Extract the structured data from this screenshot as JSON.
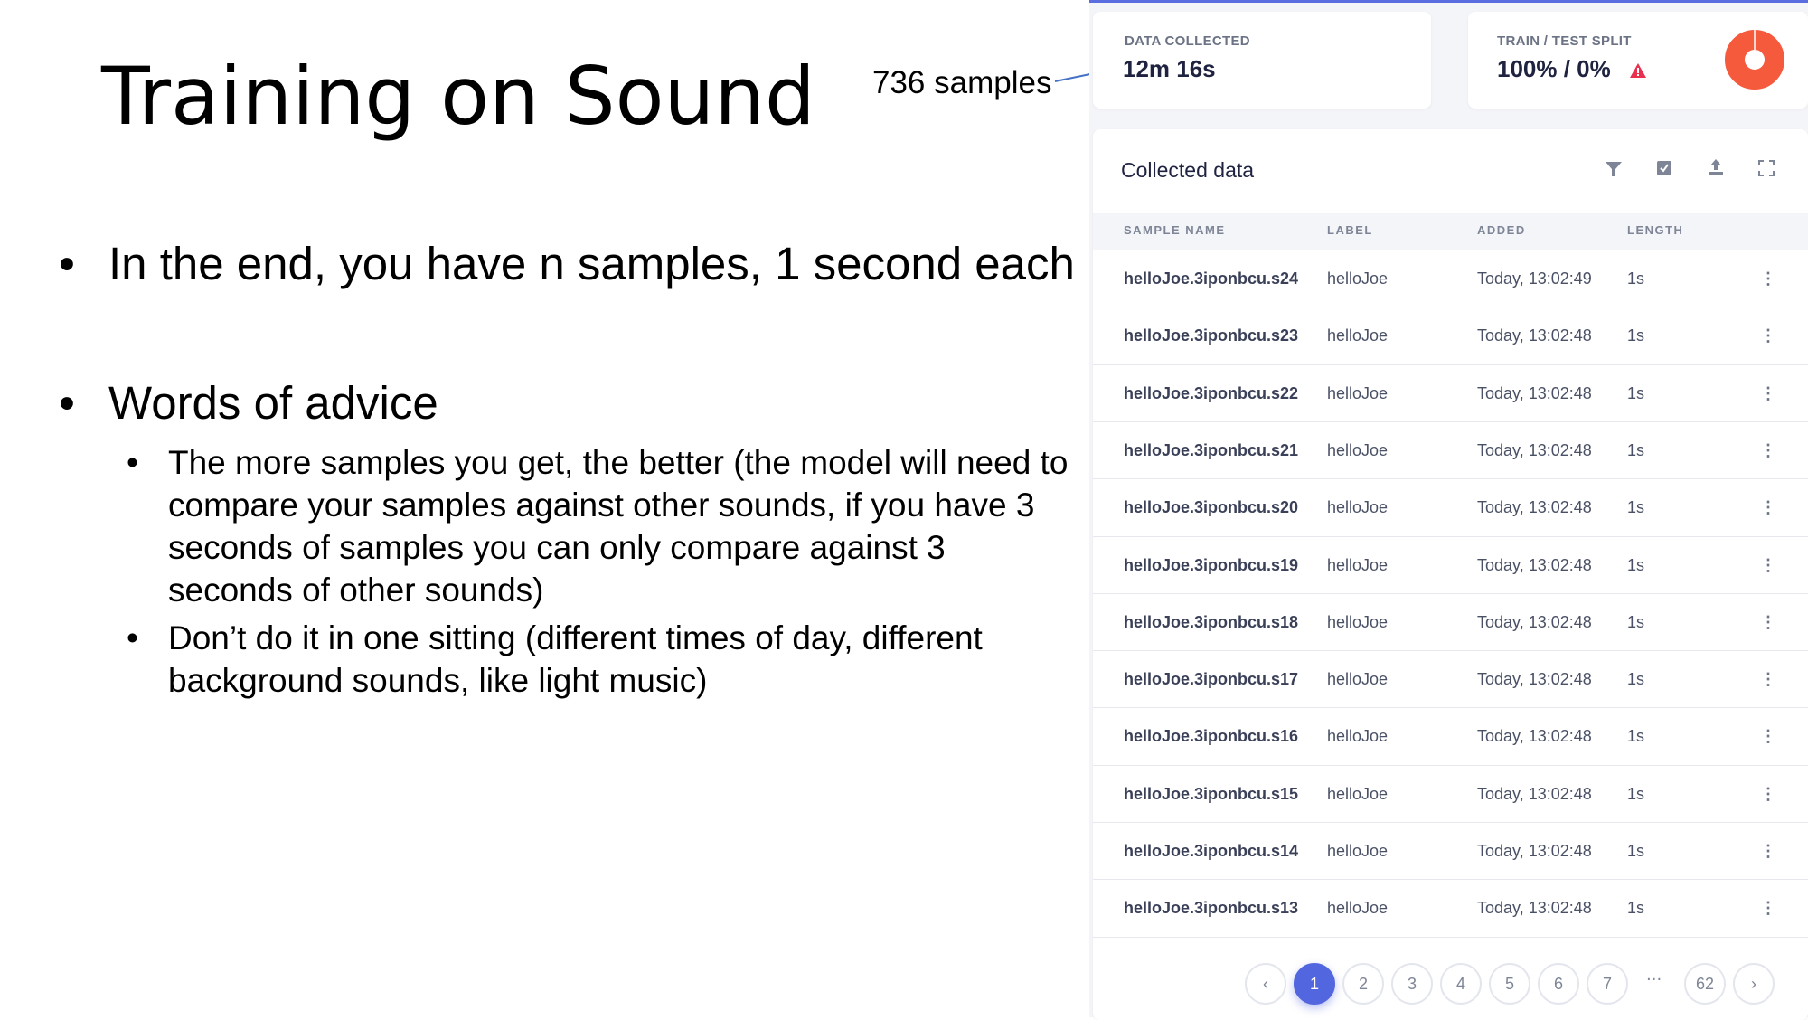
{
  "slide": {
    "title": "Training on Sound",
    "annotation": "736 samples",
    "bullets": [
      {
        "text": "In the end, you have n samples, 1 second each"
      },
      {
        "text": "Words of advice",
        "sub": [
          "The more samples you get, the better (the model will need to compare your samples against other sounds, if you have 3 seconds of samples you can only compare against 3 seconds of other sounds)",
          "Don’t do it in one sitting (different times of day, different background sounds, like light music)"
        ]
      }
    ]
  },
  "stats": {
    "data_collected_label": "DATA COLLECTED",
    "data_collected_value": "12m 16s",
    "split_label": "TRAIN / TEST SPLIT",
    "split_value": "100% / 0%",
    "train_fraction": 1.0,
    "accent": "#f55a3c"
  },
  "table": {
    "title": "Collected data",
    "headers": [
      "SAMPLE NAME",
      "LABEL",
      "ADDED",
      "LENGTH"
    ],
    "rows": [
      [
        "helloJoe.3iponbcu.s24",
        "helloJoe",
        "Today, 13:02:49",
        "1s"
      ],
      [
        "helloJoe.3iponbcu.s23",
        "helloJoe",
        "Today, 13:02:48",
        "1s"
      ],
      [
        "helloJoe.3iponbcu.s22",
        "helloJoe",
        "Today, 13:02:48",
        "1s"
      ],
      [
        "helloJoe.3iponbcu.s21",
        "helloJoe",
        "Today, 13:02:48",
        "1s"
      ],
      [
        "helloJoe.3iponbcu.s20",
        "helloJoe",
        "Today, 13:02:48",
        "1s"
      ],
      [
        "helloJoe.3iponbcu.s19",
        "helloJoe",
        "Today, 13:02:48",
        "1s"
      ],
      [
        "helloJoe.3iponbcu.s18",
        "helloJoe",
        "Today, 13:02:48",
        "1s"
      ],
      [
        "helloJoe.3iponbcu.s17",
        "helloJoe",
        "Today, 13:02:48",
        "1s"
      ],
      [
        "helloJoe.3iponbcu.s16",
        "helloJoe",
        "Today, 13:02:48",
        "1s"
      ],
      [
        "helloJoe.3iponbcu.s15",
        "helloJoe",
        "Today, 13:02:48",
        "1s"
      ],
      [
        "helloJoe.3iponbcu.s14",
        "helloJoe",
        "Today, 13:02:48",
        "1s"
      ],
      [
        "helloJoe.3iponbcu.s13",
        "helloJoe",
        "Today, 13:02:48",
        "1s"
      ]
    ]
  },
  "pagination": {
    "pages": [
      "1",
      "2",
      "3",
      "4",
      "5",
      "6",
      "7"
    ],
    "ellipsis": "···",
    "last": "62",
    "current": "1"
  }
}
